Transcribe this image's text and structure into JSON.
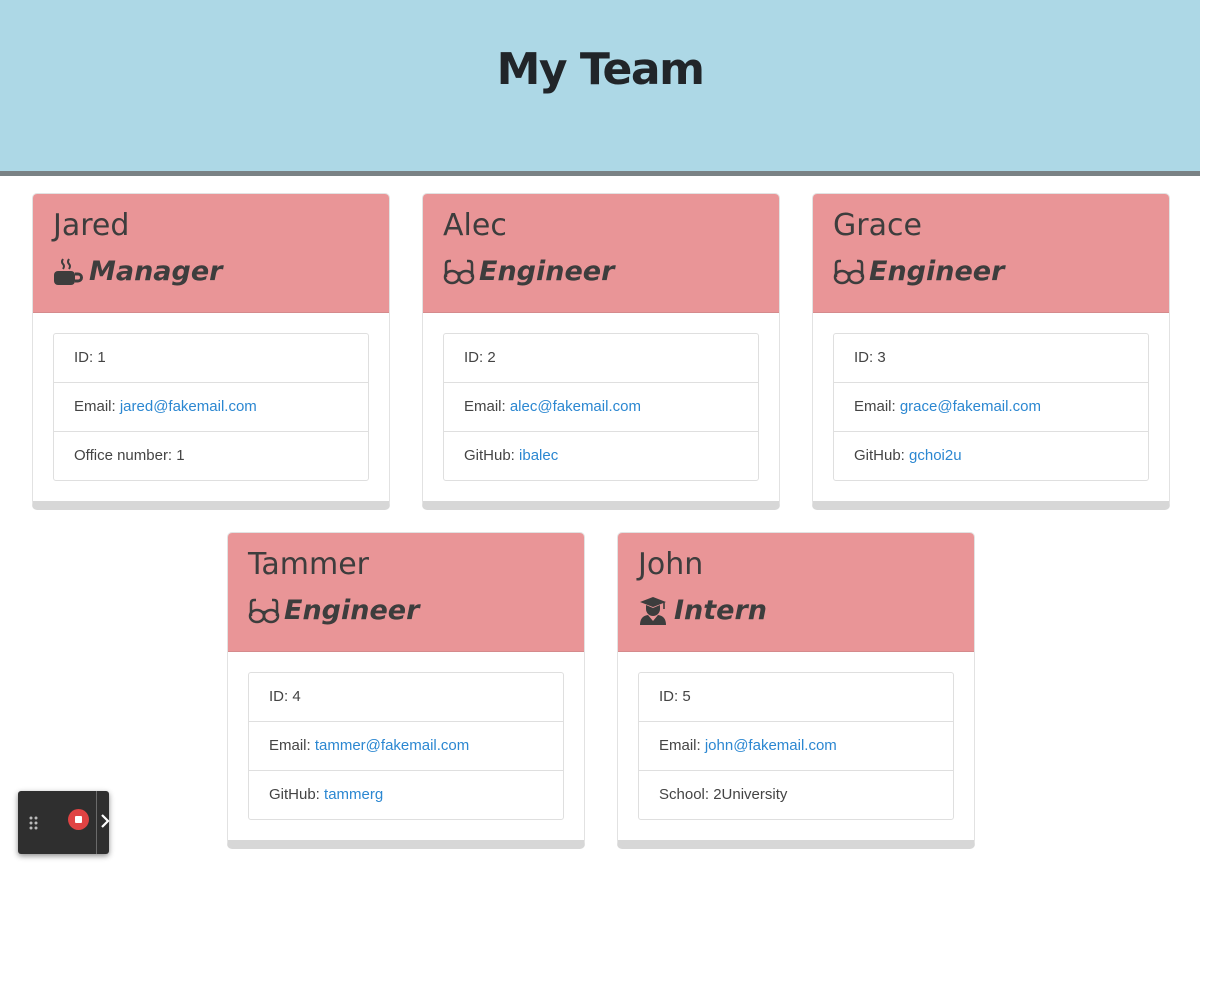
{
  "header": {
    "title": "My Team"
  },
  "cards": [
    {
      "name": "Jared",
      "role": "Manager",
      "icon": "coffee-icon",
      "id_text": "ID: 1",
      "email_label": "Email: ",
      "email": "jared@fakemail.com",
      "extra_label": "Office number: 1",
      "extra_link": ""
    },
    {
      "name": "Alec",
      "role": "Engineer",
      "icon": "glasses-icon",
      "id_text": "ID: 2",
      "email_label": "Email: ",
      "email": "alec@fakemail.com",
      "extra_label": "GitHub: ",
      "extra_link": "ibalec"
    },
    {
      "name": "Grace",
      "role": "Engineer",
      "icon": "glasses-icon",
      "id_text": "ID: 3",
      "email_label": "Email: ",
      "email": "grace@fakemail.com",
      "extra_label": "GitHub: ",
      "extra_link": "gchoi2u"
    },
    {
      "name": "Tammer",
      "role": "Engineer",
      "icon": "glasses-icon",
      "id_text": "ID: 4",
      "email_label": "Email: ",
      "email": "tammer@fakemail.com",
      "extra_label": "GitHub: ",
      "extra_link": "tammerg"
    },
    {
      "name": "John",
      "role": "Intern",
      "icon": "graduate-icon",
      "id_text": "ID: 5",
      "email_label": "Email: ",
      "email": "john@fakemail.com",
      "extra_label": "School: 2University",
      "extra_link": ""
    }
  ],
  "colors": {
    "header_bg": "#add8e6",
    "card_header": "#e99597",
    "link": "#2b87d1"
  },
  "recorder": {
    "icons": [
      "drag-handle-icon",
      "stop-record-icon",
      "chevron-right-icon"
    ]
  }
}
